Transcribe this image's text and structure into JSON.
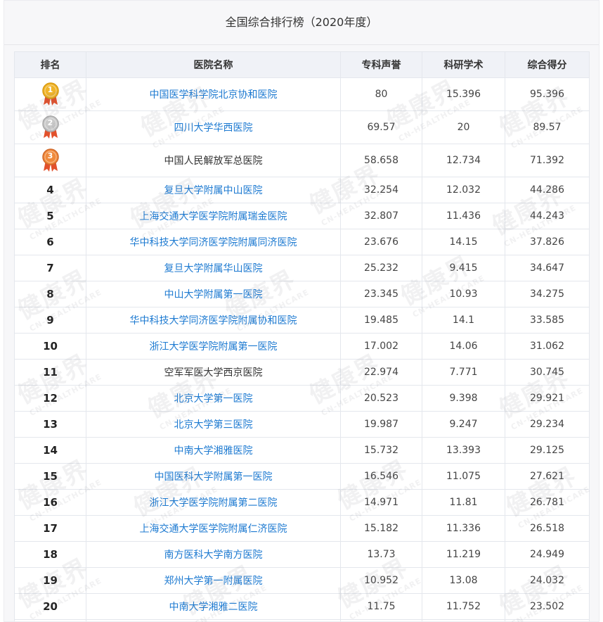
{
  "title": "全国综合排行榜（2020年度）",
  "watermark": {
    "cn": "健康界",
    "en": "CN-HEALTHCARE"
  },
  "colors": {
    "link": "#1d7ad1",
    "header_bg": "#f0f2f7",
    "gold": "#f0b429",
    "silver": "#c9c9c9",
    "bronze": "#f08a3c",
    "ribbon": "#e2502b"
  },
  "table": {
    "headers": [
      "排名",
      "医院名称",
      "专科声誉",
      "科研学术",
      "综合得分"
    ],
    "rows": [
      {
        "rank": "1",
        "medal": "gold",
        "name": "中国医学科学院北京协和医院",
        "link": true,
        "reputation": "80",
        "research": "15.396",
        "total": "95.396"
      },
      {
        "rank": "2",
        "medal": "silver",
        "name": "四川大学华西医院",
        "link": true,
        "reputation": "69.57",
        "research": "20",
        "total": "89.57"
      },
      {
        "rank": "3",
        "medal": "bronze",
        "name": "中国人民解放军总医院",
        "link": false,
        "reputation": "58.658",
        "research": "12.734",
        "total": "71.392"
      },
      {
        "rank": "4",
        "name": "复旦大学附属中山医院",
        "link": true,
        "reputation": "32.254",
        "research": "12.032",
        "total": "44.286"
      },
      {
        "rank": "5",
        "name": "上海交通大学医学院附属瑞金医院",
        "link": true,
        "reputation": "32.807",
        "research": "11.436",
        "total": "44.243"
      },
      {
        "rank": "6",
        "name": "华中科技大学同济医学院附属同济医院",
        "link": true,
        "reputation": "23.676",
        "research": "14.15",
        "total": "37.826"
      },
      {
        "rank": "7",
        "name": "复旦大学附属华山医院",
        "link": true,
        "reputation": "25.232",
        "research": "9.415",
        "total": "34.647"
      },
      {
        "rank": "8",
        "name": "中山大学附属第一医院",
        "link": true,
        "reputation": "23.345",
        "research": "10.93",
        "total": "34.275"
      },
      {
        "rank": "9",
        "name": "华中科技大学同济医学院附属协和医院",
        "link": true,
        "reputation": "19.485",
        "research": "14.1",
        "total": "33.585"
      },
      {
        "rank": "10",
        "name": "浙江大学医学院附属第一医院",
        "link": true,
        "reputation": "17.002",
        "research": "14.06",
        "total": "31.062"
      },
      {
        "rank": "11",
        "name": "空军军医大学西京医院",
        "link": false,
        "reputation": "22.974",
        "research": "7.771",
        "total": "30.745"
      },
      {
        "rank": "12",
        "name": "北京大学第一医院",
        "link": true,
        "reputation": "20.523",
        "research": "9.398",
        "total": "29.921"
      },
      {
        "rank": "13",
        "name": "北京大学第三医院",
        "link": true,
        "reputation": "19.987",
        "research": "9.247",
        "total": "29.234"
      },
      {
        "rank": "14",
        "name": "中南大学湘雅医院",
        "link": true,
        "reputation": "15.732",
        "research": "13.393",
        "total": "29.125"
      },
      {
        "rank": "15",
        "name": "中国医科大学附属第一医院",
        "link": true,
        "reputation": "16.546",
        "research": "11.075",
        "total": "27.621"
      },
      {
        "rank": "16",
        "name": "浙江大学医学院附属第二医院",
        "link": true,
        "reputation": "14.971",
        "research": "11.81",
        "total": "26.781"
      },
      {
        "rank": "17",
        "name": "上海交通大学医学院附属仁济医院",
        "link": true,
        "reputation": "15.182",
        "research": "11.336",
        "total": "26.518"
      },
      {
        "rank": "18",
        "name": "南方医科大学南方医院",
        "link": true,
        "reputation": "13.73",
        "research": "11.219",
        "total": "24.949"
      },
      {
        "rank": "19",
        "name": "郑州大学第一附属医院",
        "link": true,
        "reputation": "10.952",
        "research": "13.08",
        "total": "24.032"
      },
      {
        "rank": "20",
        "name": "中南大学湘雅二医院",
        "link": true,
        "reputation": "11.75",
        "research": "11.752",
        "total": "23.502"
      },
      {
        "rank": "",
        "name": "",
        "link": false,
        "reputation": "",
        "research": "",
        "total": ""
      }
    ]
  }
}
